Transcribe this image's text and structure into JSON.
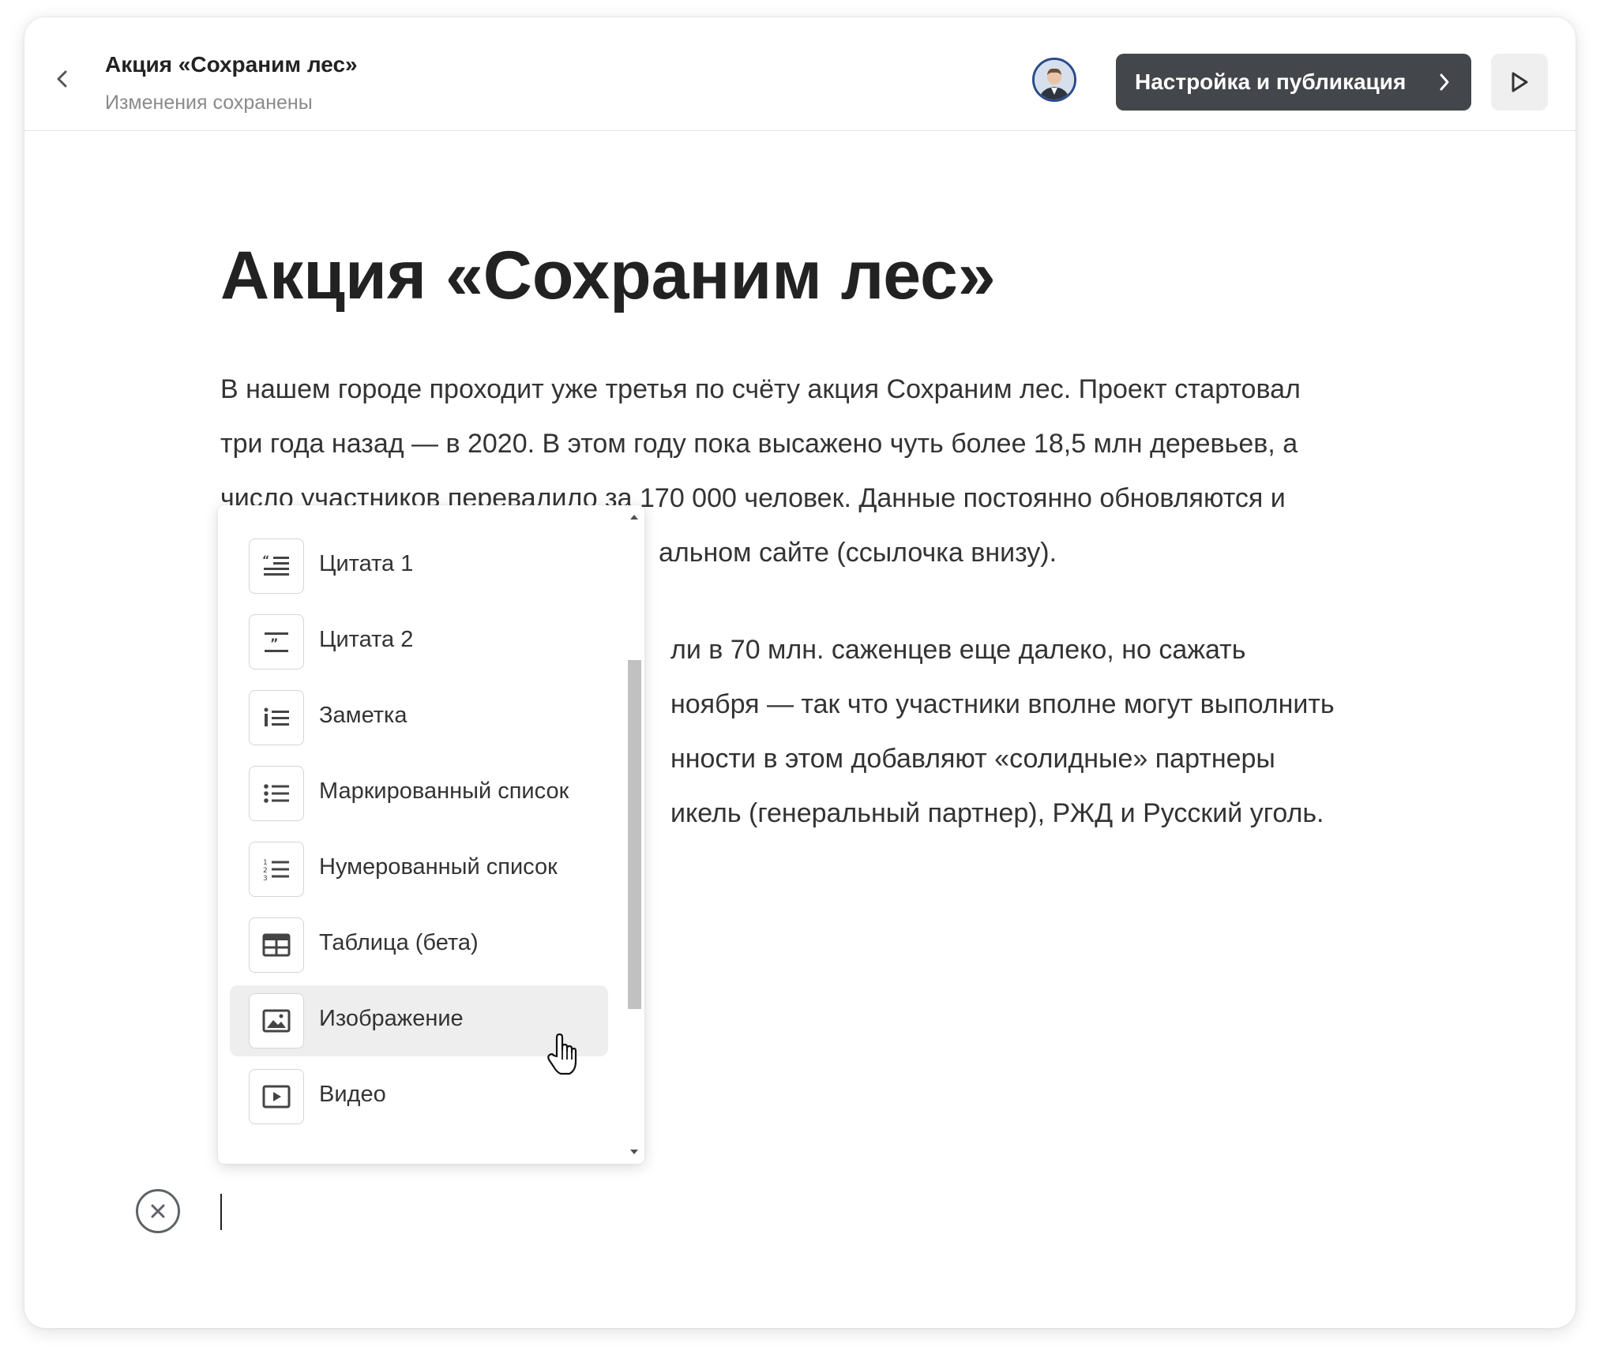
{
  "header": {
    "title": "Акция «Сохраним лес»",
    "status": "Изменения сохранены",
    "publish_label": "Настройка и публикация"
  },
  "article": {
    "title": "Акция «Сохраним лес»",
    "paragraph1": [
      "В нашем городе проходит уже третья по счёту акция Сохраним лес. Проект стартовал",
      "три года назад — в 2020. В этом году пока высажено чуть более 18,5 млн деревьев, а",
      "число участников перевалило за 170 000 человек. Данные постоянно обновляются и",
      "альном сайте (ссылочка внизу)."
    ],
    "paragraph2": [
      "ли в 70 млн. саженцев еще далеко, но сажать",
      "ноября — так что участники вполне могут выполнить",
      "нности в этом добавляют «солидные» партнеры",
      "икель (генеральный партнер), РЖД и Русский уголь."
    ]
  },
  "menu": {
    "items": [
      {
        "label": "Цитата 1",
        "icon": "quote-1-icon"
      },
      {
        "label": "Цитата 2",
        "icon": "quote-2-icon"
      },
      {
        "label": "Заметка",
        "icon": "note-icon"
      },
      {
        "label": "Маркированный список",
        "icon": "bulleted-list-icon"
      },
      {
        "label": "Нумерованный список",
        "icon": "numbered-list-icon"
      },
      {
        "label": "Таблица (бета)",
        "icon": "table-icon"
      },
      {
        "label": "Изображение",
        "icon": "image-icon",
        "active": true
      },
      {
        "label": "Видео",
        "icon": "video-icon"
      }
    ]
  },
  "colors": {
    "publish_bg": "#43464a",
    "active_item_bg": "#eeeeee",
    "avatar_border": "#2b4a8a"
  }
}
